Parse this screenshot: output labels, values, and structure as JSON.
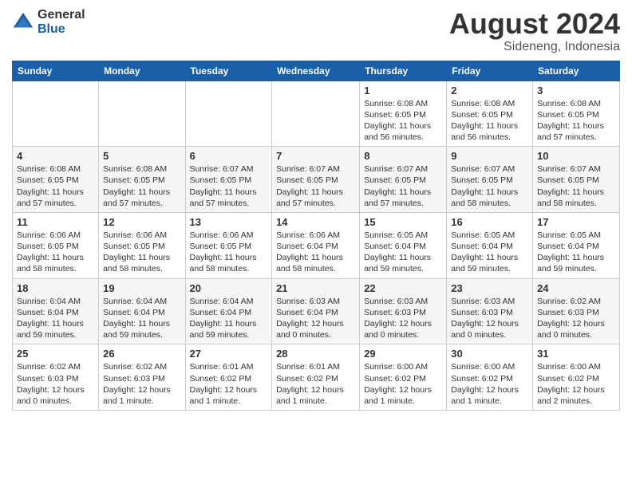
{
  "logo": {
    "general": "General",
    "blue": "Blue"
  },
  "title": "August 2024",
  "subtitle": "Sideneng, Indonesia",
  "weekdays": [
    "Sunday",
    "Monday",
    "Tuesday",
    "Wednesday",
    "Thursday",
    "Friday",
    "Saturday"
  ],
  "weeks": [
    [
      {
        "day": "",
        "info": ""
      },
      {
        "day": "",
        "info": ""
      },
      {
        "day": "",
        "info": ""
      },
      {
        "day": "",
        "info": ""
      },
      {
        "day": "1",
        "info": "Sunrise: 6:08 AM\nSunset: 6:05 PM\nDaylight: 11 hours\nand 56 minutes."
      },
      {
        "day": "2",
        "info": "Sunrise: 6:08 AM\nSunset: 6:05 PM\nDaylight: 11 hours\nand 56 minutes."
      },
      {
        "day": "3",
        "info": "Sunrise: 6:08 AM\nSunset: 6:05 PM\nDaylight: 11 hours\nand 57 minutes."
      }
    ],
    [
      {
        "day": "4",
        "info": "Sunrise: 6:08 AM\nSunset: 6:05 PM\nDaylight: 11 hours\nand 57 minutes."
      },
      {
        "day": "5",
        "info": "Sunrise: 6:08 AM\nSunset: 6:05 PM\nDaylight: 11 hours\nand 57 minutes."
      },
      {
        "day": "6",
        "info": "Sunrise: 6:07 AM\nSunset: 6:05 PM\nDaylight: 11 hours\nand 57 minutes."
      },
      {
        "day": "7",
        "info": "Sunrise: 6:07 AM\nSunset: 6:05 PM\nDaylight: 11 hours\nand 57 minutes."
      },
      {
        "day": "8",
        "info": "Sunrise: 6:07 AM\nSunset: 6:05 PM\nDaylight: 11 hours\nand 57 minutes."
      },
      {
        "day": "9",
        "info": "Sunrise: 6:07 AM\nSunset: 6:05 PM\nDaylight: 11 hours\nand 58 minutes."
      },
      {
        "day": "10",
        "info": "Sunrise: 6:07 AM\nSunset: 6:05 PM\nDaylight: 11 hours\nand 58 minutes."
      }
    ],
    [
      {
        "day": "11",
        "info": "Sunrise: 6:06 AM\nSunset: 6:05 PM\nDaylight: 11 hours\nand 58 minutes."
      },
      {
        "day": "12",
        "info": "Sunrise: 6:06 AM\nSunset: 6:05 PM\nDaylight: 11 hours\nand 58 minutes."
      },
      {
        "day": "13",
        "info": "Sunrise: 6:06 AM\nSunset: 6:05 PM\nDaylight: 11 hours\nand 58 minutes."
      },
      {
        "day": "14",
        "info": "Sunrise: 6:06 AM\nSunset: 6:04 PM\nDaylight: 11 hours\nand 58 minutes."
      },
      {
        "day": "15",
        "info": "Sunrise: 6:05 AM\nSunset: 6:04 PM\nDaylight: 11 hours\nand 59 minutes."
      },
      {
        "day": "16",
        "info": "Sunrise: 6:05 AM\nSunset: 6:04 PM\nDaylight: 11 hours\nand 59 minutes."
      },
      {
        "day": "17",
        "info": "Sunrise: 6:05 AM\nSunset: 6:04 PM\nDaylight: 11 hours\nand 59 minutes."
      }
    ],
    [
      {
        "day": "18",
        "info": "Sunrise: 6:04 AM\nSunset: 6:04 PM\nDaylight: 11 hours\nand 59 minutes."
      },
      {
        "day": "19",
        "info": "Sunrise: 6:04 AM\nSunset: 6:04 PM\nDaylight: 11 hours\nand 59 minutes."
      },
      {
        "day": "20",
        "info": "Sunrise: 6:04 AM\nSunset: 6:04 PM\nDaylight: 11 hours\nand 59 minutes."
      },
      {
        "day": "21",
        "info": "Sunrise: 6:03 AM\nSunset: 6:04 PM\nDaylight: 12 hours\nand 0 minutes."
      },
      {
        "day": "22",
        "info": "Sunrise: 6:03 AM\nSunset: 6:03 PM\nDaylight: 12 hours\nand 0 minutes."
      },
      {
        "day": "23",
        "info": "Sunrise: 6:03 AM\nSunset: 6:03 PM\nDaylight: 12 hours\nand 0 minutes."
      },
      {
        "day": "24",
        "info": "Sunrise: 6:02 AM\nSunset: 6:03 PM\nDaylight: 12 hours\nand 0 minutes."
      }
    ],
    [
      {
        "day": "25",
        "info": "Sunrise: 6:02 AM\nSunset: 6:03 PM\nDaylight: 12 hours\nand 0 minutes."
      },
      {
        "day": "26",
        "info": "Sunrise: 6:02 AM\nSunset: 6:03 PM\nDaylight: 12 hours\nand 1 minute."
      },
      {
        "day": "27",
        "info": "Sunrise: 6:01 AM\nSunset: 6:02 PM\nDaylight: 12 hours\nand 1 minute."
      },
      {
        "day": "28",
        "info": "Sunrise: 6:01 AM\nSunset: 6:02 PM\nDaylight: 12 hours\nand 1 minute."
      },
      {
        "day": "29",
        "info": "Sunrise: 6:00 AM\nSunset: 6:02 PM\nDaylight: 12 hours\nand 1 minute."
      },
      {
        "day": "30",
        "info": "Sunrise: 6:00 AM\nSunset: 6:02 PM\nDaylight: 12 hours\nand 1 minute."
      },
      {
        "day": "31",
        "info": "Sunrise: 6:00 AM\nSunset: 6:02 PM\nDaylight: 12 hours\nand 2 minutes."
      }
    ]
  ]
}
